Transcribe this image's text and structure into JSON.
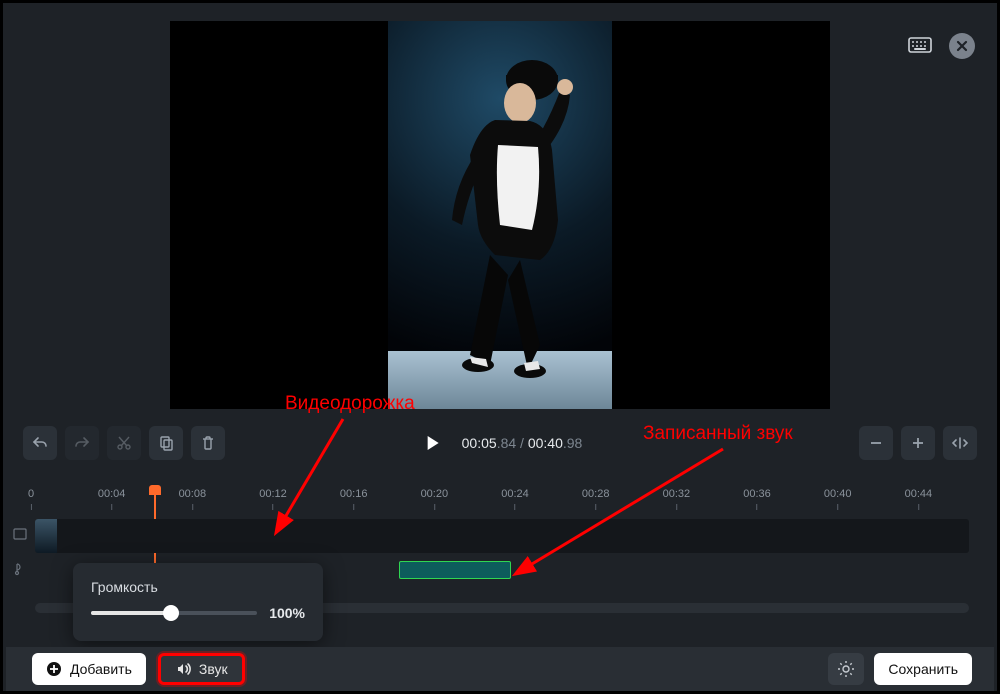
{
  "time": {
    "current": "00:05",
    "current_frac": ".84",
    "total": "00:40",
    "total_frac": ".98"
  },
  "ruler": [
    {
      "label": "0",
      "pct": 0
    },
    {
      "label": "00:04",
      "pct": 8.6
    },
    {
      "label": "00:08",
      "pct": 17.2
    },
    {
      "label": "00:12",
      "pct": 25.8
    },
    {
      "label": "00:16",
      "pct": 34.4
    },
    {
      "label": "00:20",
      "pct": 43.0
    },
    {
      "label": "00:24",
      "pct": 51.6
    },
    {
      "label": "00:28",
      "pct": 60.2
    },
    {
      "label": "00:32",
      "pct": 68.8
    },
    {
      "label": "00:36",
      "pct": 77.4
    },
    {
      "label": "00:40",
      "pct": 86.0
    },
    {
      "label": "00:44",
      "pct": 94.6
    }
  ],
  "playhead_pct": 13.0,
  "audio_clip": {
    "left_pct": 39.0,
    "width_pct": 12.0
  },
  "volume": {
    "label": "Громкость",
    "value": "100%"
  },
  "buttons": {
    "add": "Добавить",
    "sound": "Звук",
    "save": "Сохранить"
  },
  "annotations": {
    "video_track": "Видеодорожка",
    "recorded_audio": "Записанный звук"
  }
}
